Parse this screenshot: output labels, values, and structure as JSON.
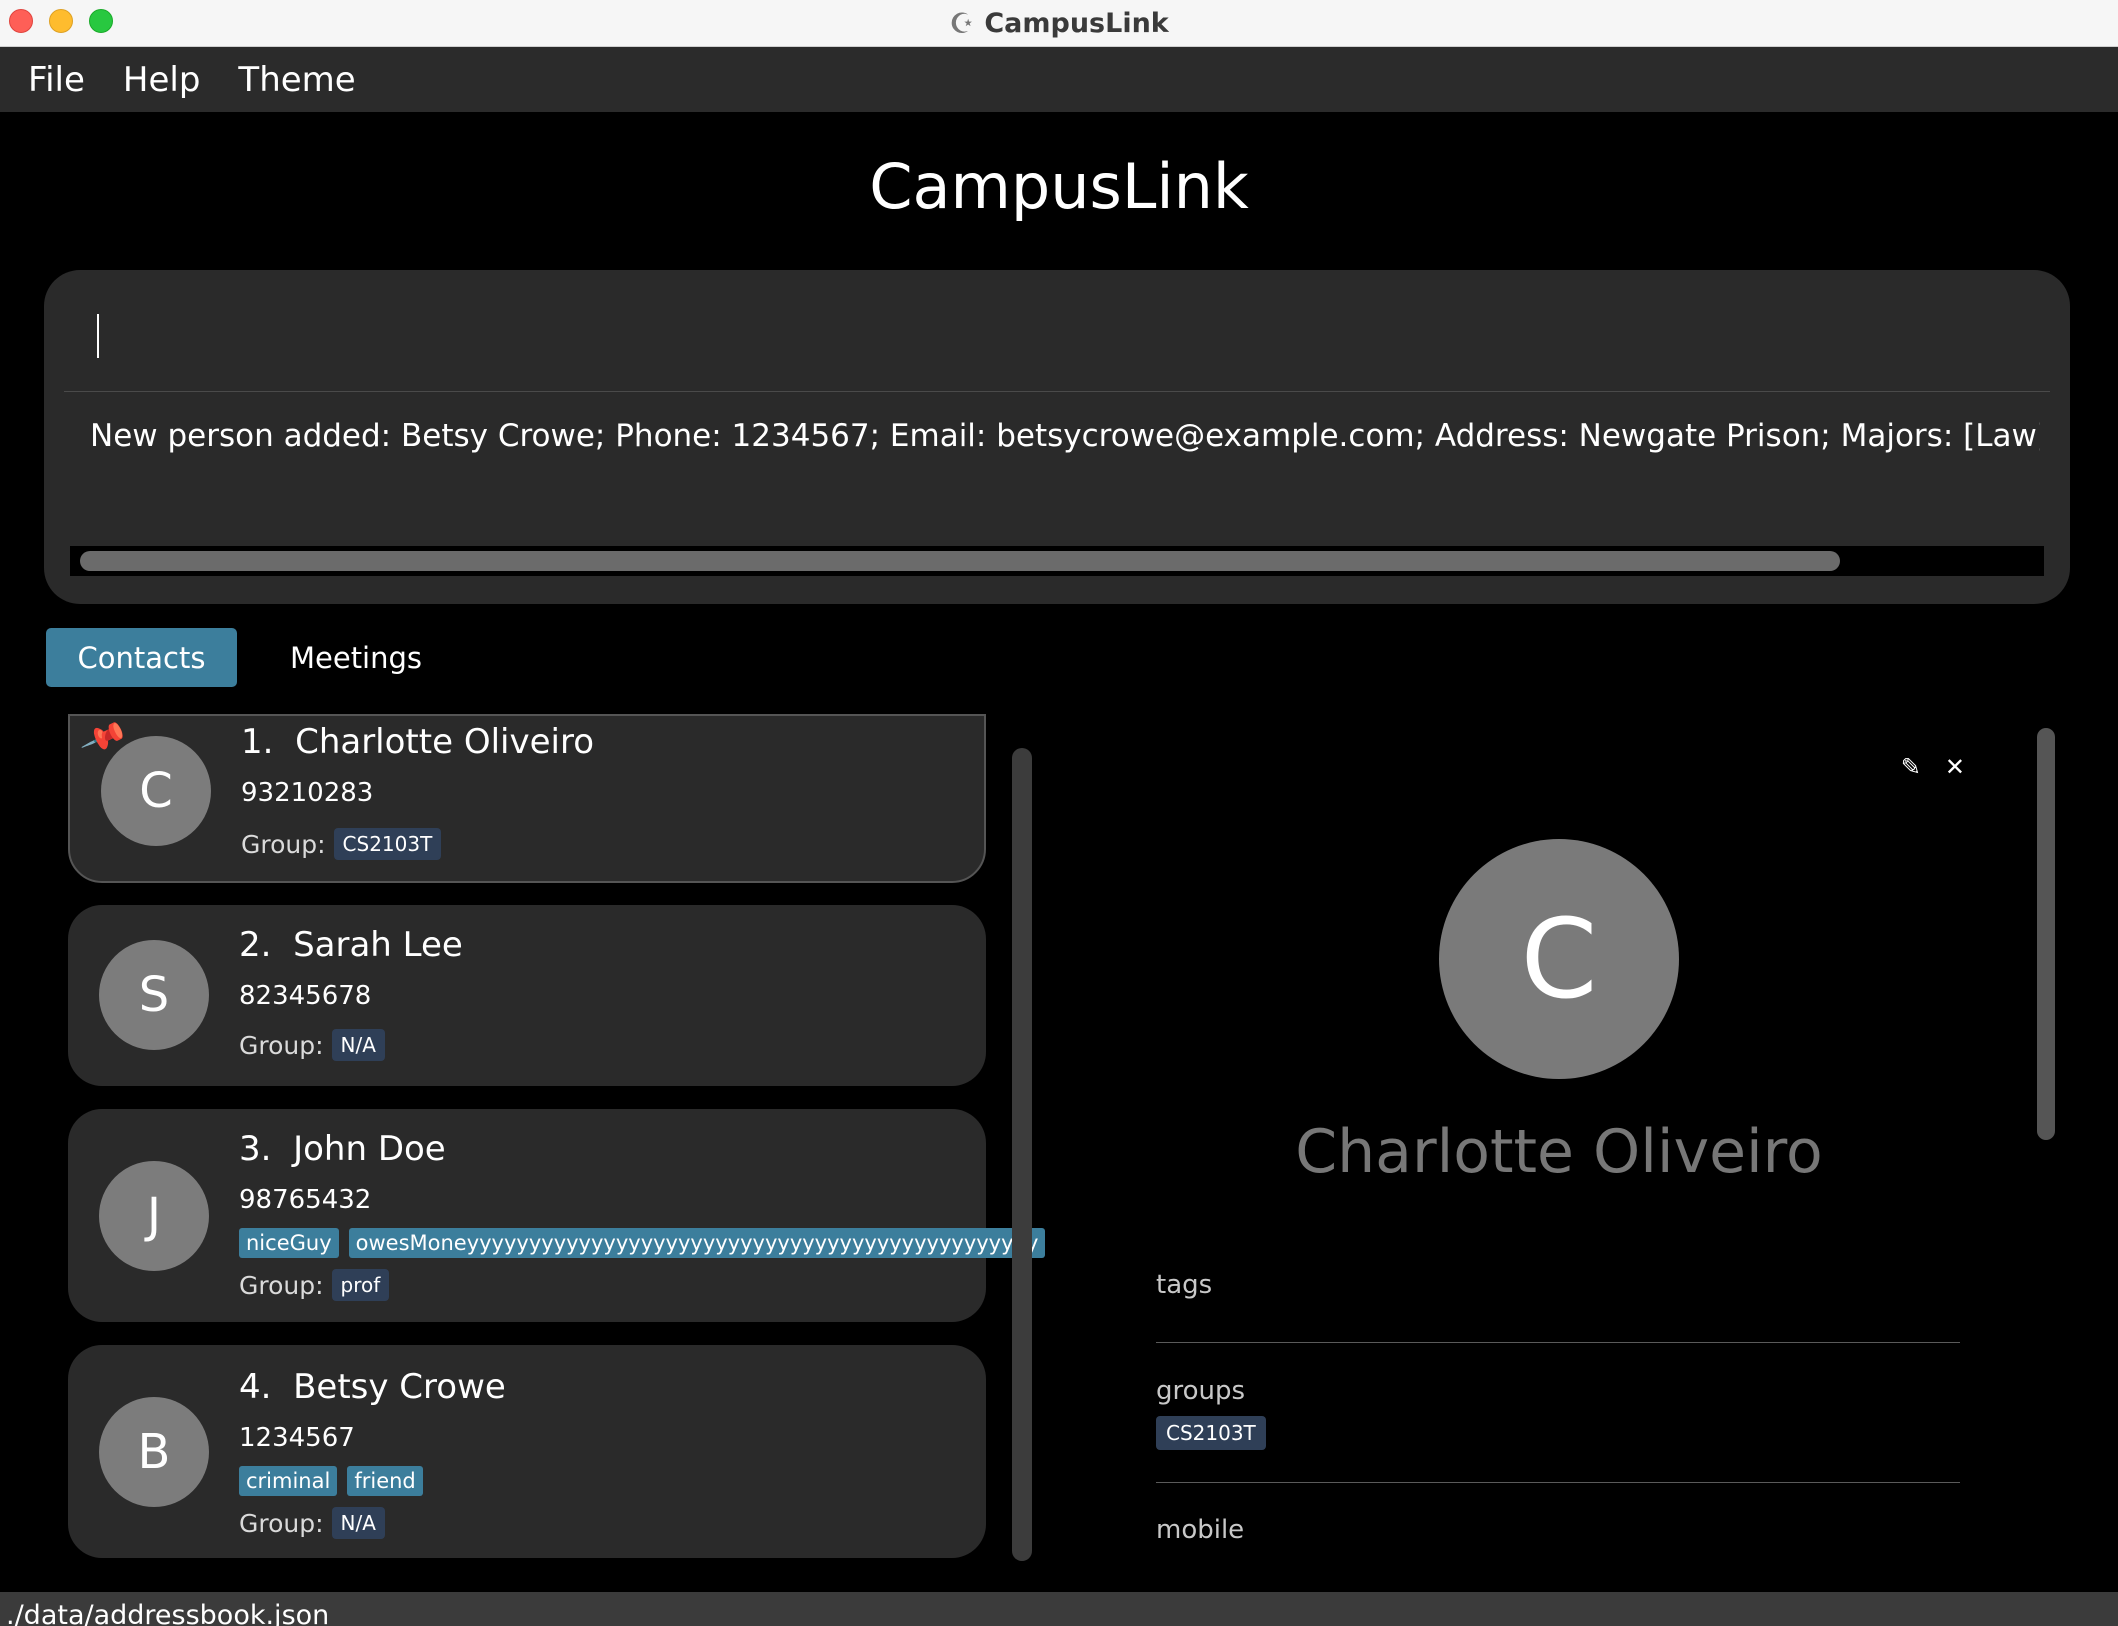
{
  "window": {
    "title": "CampusLink"
  },
  "menu": {
    "file": "File",
    "help": "Help",
    "theme": "Theme"
  },
  "app": {
    "title": "CampusLink"
  },
  "command": {
    "input_value": "",
    "result": "New person added: Betsy Crowe; Phone: 1234567; Email: betsycrowe@example.com; Address: Newgate Prison; Majors: [Law]; Tag: [friend][criminal]"
  },
  "tabs": {
    "contacts": "Contacts",
    "meetings": "Meetings"
  },
  "contacts": [
    {
      "index": "1.",
      "name": "Charlotte Oliveiro",
      "phone": "93210283",
      "group_label": "Group:",
      "group": "CS2103T",
      "avatar": "C",
      "pinned": true
    },
    {
      "index": "2.",
      "name": "Sarah Lee",
      "phone": "82345678",
      "group_label": "Group:",
      "group": "N/A",
      "avatar": "S"
    },
    {
      "index": "3.",
      "name": "John Doe",
      "phone": "98765432",
      "tags": [
        "niceGuy",
        "owesMoneyyyyyyyyyyyyyyyyyyyyyyyyyyyyyyyyyyyyyyyyyyyyyy"
      ],
      "group_label": "Group:",
      "group": "prof",
      "avatar": "J"
    },
    {
      "index": "4.",
      "name": "Betsy Crowe",
      "phone": "1234567",
      "tags": [
        "criminal",
        "friend"
      ],
      "group_label": "Group:",
      "group": "N/A",
      "avatar": "B"
    }
  ],
  "detail": {
    "avatar": "C",
    "name": "Charlotte Oliveiro",
    "tags_label": "tags",
    "groups_label": "groups",
    "group": "CS2103T",
    "mobile_label": "mobile",
    "edit_icon": "✎",
    "close_icon": "✕"
  },
  "status": {
    "path": "./data/addressbook.json"
  },
  "icons": {
    "pin": "📌",
    "app": "☪"
  },
  "colors": {
    "accent": "#3c7e9c",
    "group_badge": "#2f3f57",
    "panel": "#2a2a2a",
    "background": "#000000"
  }
}
